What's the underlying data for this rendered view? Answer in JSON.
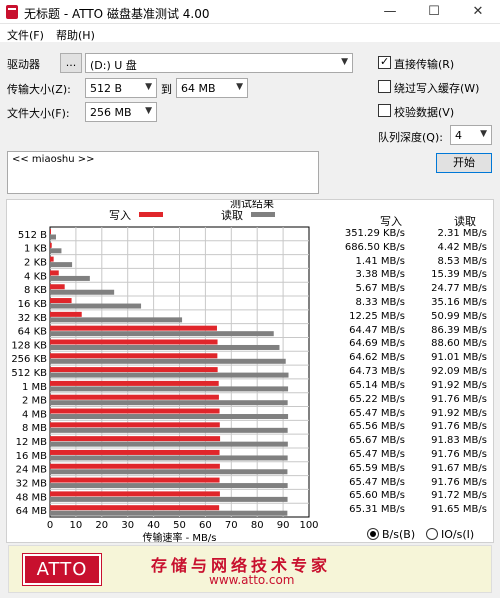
{
  "window": {
    "title": "无标题 - ATTO 磁盘基准测试 4.00",
    "minimize": "—",
    "maximize": "☐",
    "close": "✕"
  },
  "menu": {
    "file": "文件(F)",
    "help": "帮助(H)"
  },
  "controls": {
    "drive_label": "驱动器",
    "browse_label": "...",
    "drive_value": "(D:) U 盘",
    "transfer_label": "传输大小(Z):",
    "transfer_from": "512 B",
    "to_label": "到",
    "transfer_to": "64 MB",
    "filesize_label": "文件大小(F):",
    "filesize_value": "256 MB",
    "direct_io": "直接传输(R)",
    "bypass_cache": "绕过写入缓存(W)",
    "verify_data": "校验数据(V)",
    "queue_depth_label": "队列深度(Q):",
    "queue_depth_value": "4",
    "start_button": "开始",
    "notes_text": "<< miaoshu >>"
  },
  "results": {
    "title": "测试结果",
    "write_col": "写入",
    "read_col": "读取",
    "unit_bps": "B/s(B)",
    "unit_ios": "IO/s(I)"
  },
  "chart_data": {
    "type": "bar",
    "orientation": "horizontal",
    "title": "测试结果",
    "xlabel": "传输速率 - MB/s",
    "xlim": [
      0,
      100
    ],
    "xticks": [
      0,
      10,
      20,
      30,
      40,
      50,
      60,
      70,
      80,
      90,
      100
    ],
    "grid": true,
    "legend_position": "top",
    "categories": [
      "512 B",
      "1 KB",
      "2 KB",
      "4 KB",
      "8 KB",
      "16 KB",
      "32 KB",
      "64 KB",
      "128 KB",
      "256 KB",
      "512 KB",
      "1 MB",
      "2 MB",
      "4 MB",
      "8 MB",
      "12 MB",
      "16 MB",
      "24 MB",
      "32 MB",
      "48 MB",
      "64 MB"
    ],
    "series": [
      {
        "name": "写入",
        "color": "#e0262b",
        "values": [
          0.34,
          0.67,
          1.41,
          3.38,
          5.67,
          8.33,
          12.25,
          64.47,
          64.69,
          64.62,
          64.73,
          65.14,
          65.22,
          65.47,
          65.56,
          65.67,
          65.47,
          65.59,
          65.47,
          65.6,
          65.31
        ],
        "labels": [
          "351.29 KB/s",
          "686.50 KB/s",
          "1.41 MB/s",
          "3.38 MB/s",
          "5.67 MB/s",
          "8.33 MB/s",
          "12.25 MB/s",
          "64.47 MB/s",
          "64.69 MB/s",
          "64.62 MB/s",
          "64.73 MB/s",
          "65.14 MB/s",
          "65.22 MB/s",
          "65.47 MB/s",
          "65.56 MB/s",
          "65.67 MB/s",
          "65.47 MB/s",
          "65.59 MB/s",
          "65.47 MB/s",
          "65.60 MB/s",
          "65.31 MB/s"
        ]
      },
      {
        "name": "读取",
        "color": "#808080",
        "values": [
          2.31,
          4.42,
          8.53,
          15.39,
          24.77,
          35.16,
          50.99,
          86.39,
          88.6,
          91.01,
          92.09,
          91.92,
          91.76,
          91.92,
          91.76,
          91.83,
          91.76,
          91.67,
          91.76,
          91.72,
          91.65
        ],
        "labels": [
          "2.31 MB/s",
          "4.42 MB/s",
          "8.53 MB/s",
          "15.39 MB/s",
          "24.77 MB/s",
          "35.16 MB/s",
          "50.99 MB/s",
          "86.39 MB/s",
          "88.60 MB/s",
          "91.01 MB/s",
          "92.09 MB/s",
          "91.92 MB/s",
          "91.76 MB/s",
          "91.92 MB/s",
          "91.76 MB/s",
          "91.83 MB/s",
          "91.76 MB/s",
          "91.67 MB/s",
          "91.76 MB/s",
          "91.72 MB/s",
          "91.65 MB/s"
        ]
      }
    ]
  },
  "banner": {
    "logo": "ATTO",
    "slogan": "存储与网络技术专家",
    "url": "www.atto.com"
  }
}
